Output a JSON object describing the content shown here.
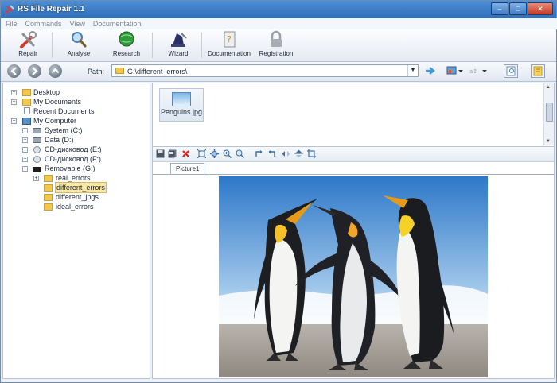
{
  "window": {
    "title": "RS File Repair 1.1"
  },
  "menu": [
    "File",
    "Commands",
    "View",
    "Documentation"
  ],
  "toolbar": {
    "repair": "Repair",
    "analyse": "Analyse",
    "research": "Research",
    "wizard": "Wizard",
    "documentation": "Documentation",
    "registration": "Registration"
  },
  "address": {
    "label": "Path:",
    "value": "G:\\different_errors\\"
  },
  "tree": {
    "desktop": "Desktop",
    "my_documents": "My Documents",
    "recent_documents": "Recent Documents",
    "my_computer": "My Computer",
    "system": "System (C:)",
    "data": "Data (D:)",
    "cd_e": "CD-дисковод (E:)",
    "cd_f": "CD-дисковод (F:)",
    "removable": "Removable (G:)",
    "real_errors": "real_errors",
    "different_errors": "different_errors",
    "different_jpgs": "different_jpgs",
    "ideal_errors": "ideal_errors"
  },
  "files": [
    {
      "name": "Penguins.jpg"
    }
  ],
  "viewer": {
    "tab": "Picture1"
  },
  "colors": {
    "titlebar": "#3a7bc8",
    "accent": "#3c9ad8",
    "selection": "#fbe8a6"
  }
}
